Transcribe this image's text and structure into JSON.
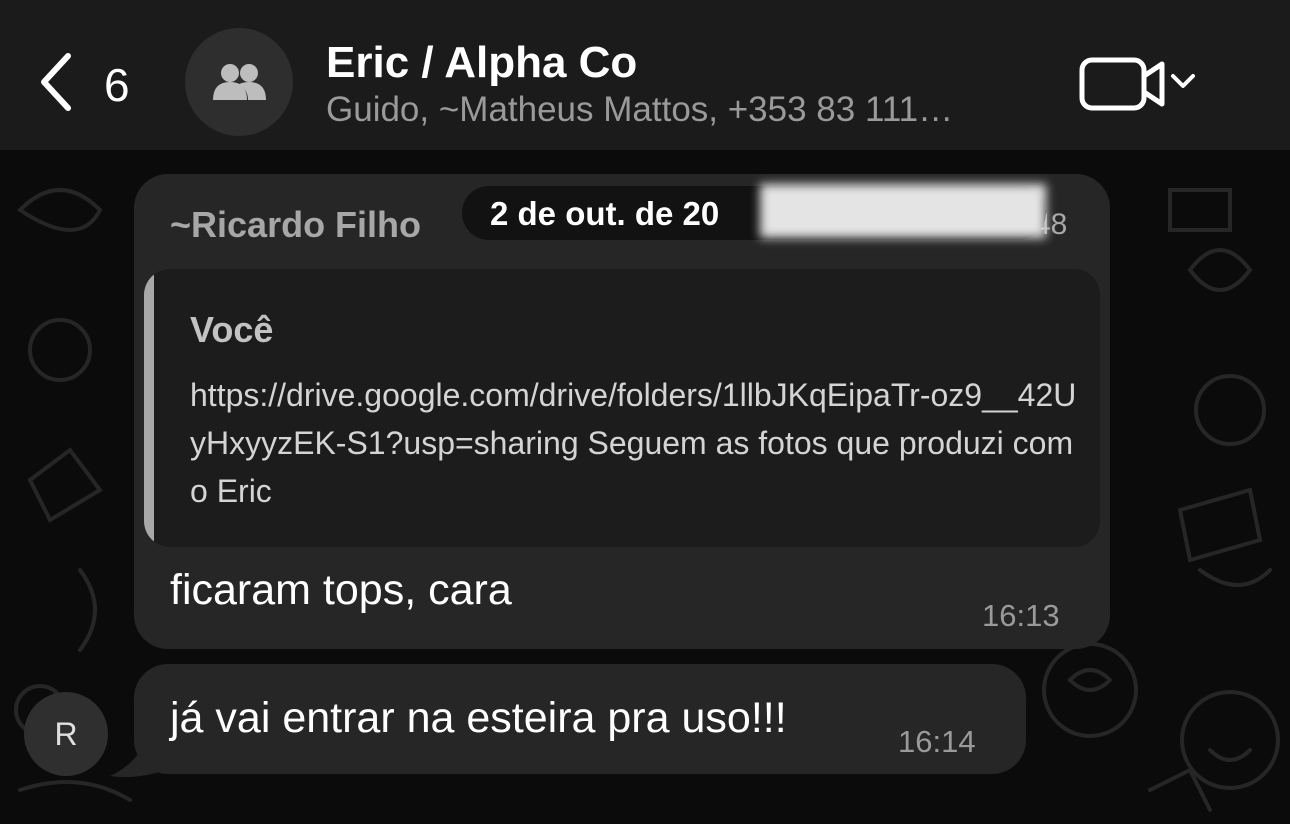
{
  "header": {
    "back_count": "6",
    "title": "Eric / Alpha Co",
    "subtitle": "Guido, ~Matheus Mattos, +353 83 111…",
    "icons": {
      "back": "chevron-left-icon",
      "avatar": "group-icon",
      "video": "video-call-icon",
      "dropdown": "chevron-down-icon"
    }
  },
  "date_pill": {
    "text": "2 de out. de 20"
  },
  "messages": [
    {
      "sender": "~Ricardo Filho",
      "sender_time_fragment": "48",
      "quote": {
        "author": "Você",
        "text": "https://drive.google.com/drive/folders/1llbJKqEipaTr-oz9__42UyHxyyzEK-S1?usp=sharing Seguem as fotos que produzi com o Eric"
      },
      "text": "ficaram tops, cara",
      "time": "16:13"
    },
    {
      "text": "já vai entrar na esteira pra uso!!!",
      "time": "16:14",
      "avatar_initial": "R"
    }
  ],
  "colors": {
    "header_bg": "#1b1b1b",
    "bubble_bg": "#262626",
    "background": "#0b0b0b"
  }
}
